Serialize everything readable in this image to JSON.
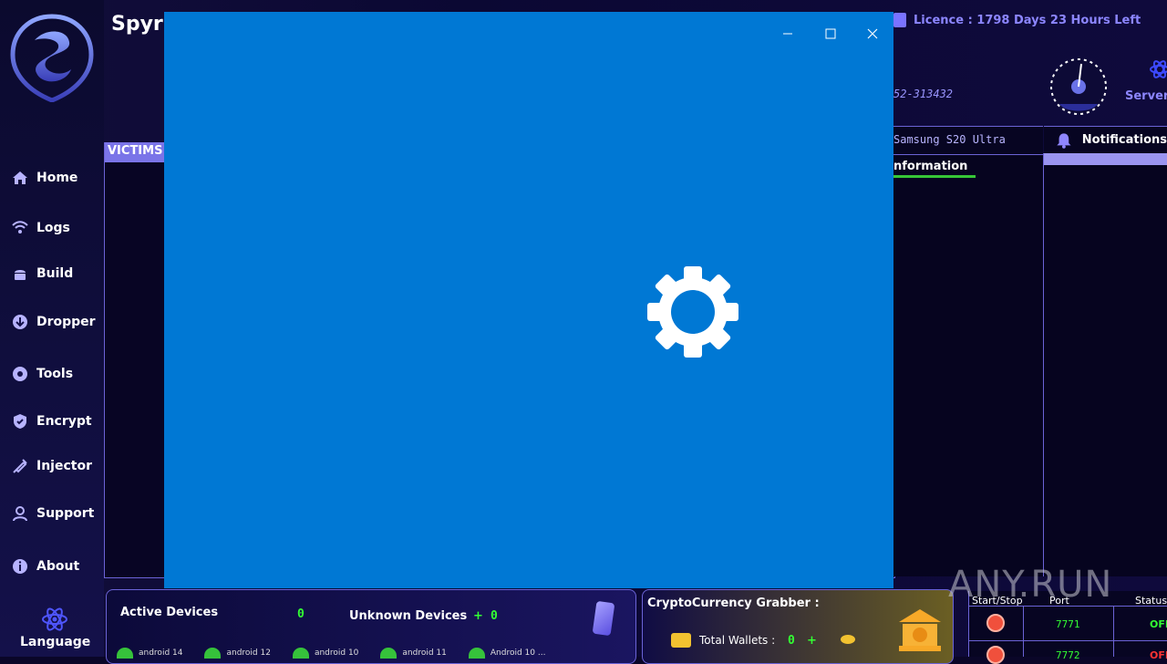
{
  "app": {
    "title": "Spyr"
  },
  "header": {
    "licence": "Licence : 1798 Days 23 Hours Left",
    "serial": "52-313432",
    "server_label": "Server"
  },
  "sidebar": {
    "items": [
      {
        "label": "Home",
        "icon": "home-icon"
      },
      {
        "label": "Logs",
        "icon": "wifi-icon"
      },
      {
        "label": "Build",
        "icon": "android-icon"
      },
      {
        "label": "Dropper",
        "icon": "download-icon"
      },
      {
        "label": "Tools",
        "icon": "tools-icon"
      },
      {
        "label": "Encrypt",
        "icon": "shield-icon"
      },
      {
        "label": "Injector",
        "icon": "syringe-icon"
      },
      {
        "label": "Support",
        "icon": "support-icon"
      },
      {
        "label": "About",
        "icon": "info-icon"
      }
    ],
    "language_label": "Language"
  },
  "victims": {
    "tab_label": "VICTIMS"
  },
  "device_panel": {
    "device_name": "Samsung S20 Ultra",
    "info_label": "nformation"
  },
  "notifications": {
    "label": "Notifications"
  },
  "bottom": {
    "active_devices_label": "Active Devices",
    "active_devices_count": "0",
    "unknown_devices_label": "Unknown Devices",
    "unknown_devices_plus": "+",
    "unknown_devices_count": "0",
    "android_items": [
      "android 14",
      "android 12",
      "android 10",
      "android 11",
      "Android 10 ..."
    ]
  },
  "crypto": {
    "title": "CryptoCurrency Grabber :",
    "wallets_label": "Total Wallets :",
    "wallets_count": "0",
    "wallets_plus": "+"
  },
  "ports": {
    "headers": [
      "Start/Stop",
      "Port",
      "Status"
    ],
    "rows": [
      {
        "port": "7771",
        "status": "OFF"
      },
      {
        "port": "7772",
        "status": "OFF"
      }
    ]
  },
  "overlay": {
    "accent": "#0078d4"
  },
  "watermark": "ANY.RUN"
}
